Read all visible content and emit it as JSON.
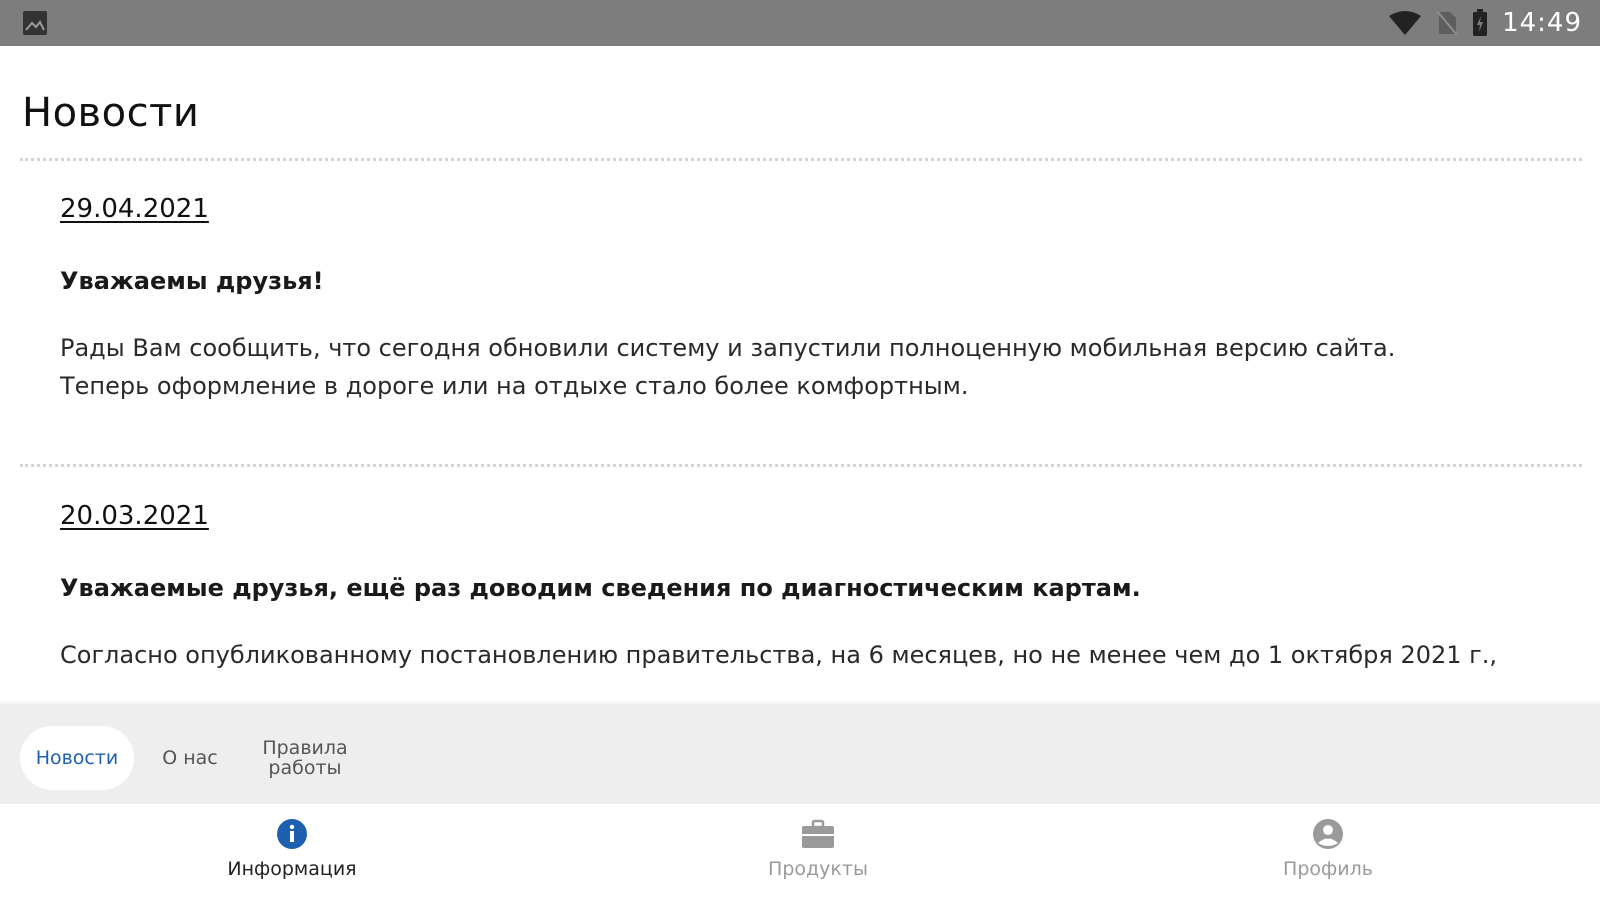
{
  "status_bar": {
    "time": "14:49",
    "icons": [
      "image-icon",
      "wifi-icon",
      "no-sim-icon",
      "battery-icon"
    ]
  },
  "page": {
    "title": "Новости"
  },
  "news": [
    {
      "date": "29.04.2021",
      "heading": "Уважаемы друзья!",
      "body": "Рады Вам сообщить, что сегодня обновили систему и запустили полноценную мобильная версию сайта.\nТеперь оформление в дороге или на отдыхе стало более комфортным."
    },
    {
      "date": "20.03.2021",
      "heading": "Уважаемые друзья, ещё раз доводим сведения по диагностическим картам.",
      "body": "Согласно опубликованному постановлению правительства, на 6 месяцев, но не менее чем до 1 октября 2021 г.,"
    }
  ],
  "subtabs": {
    "items": [
      {
        "label": "Новости",
        "active": true
      },
      {
        "label": "О нас",
        "active": false
      },
      {
        "label": "Правила\nработы",
        "active": false
      }
    ]
  },
  "bottom_nav": {
    "items": [
      {
        "label": "Информация",
        "icon": "info-icon",
        "active": true
      },
      {
        "label": "Продукты",
        "icon": "briefcase-icon",
        "active": false
      },
      {
        "label": "Профиль",
        "icon": "profile-icon",
        "active": false
      }
    ]
  },
  "colors": {
    "status_bar": "#7d7d7d",
    "accent": "#1f5fb0",
    "subtabs_bg": "#eeeeee",
    "inactive_nav": "#9a9a9a"
  }
}
